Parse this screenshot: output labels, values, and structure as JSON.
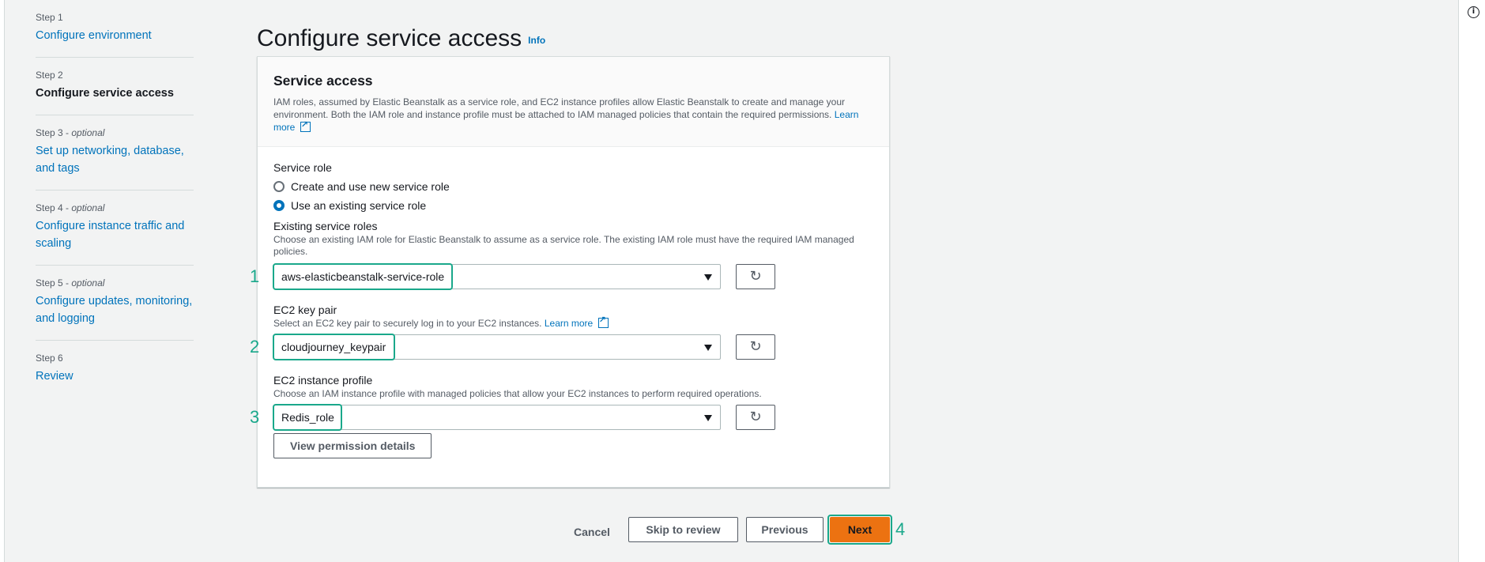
{
  "steps": [
    {
      "num": "Step 1",
      "optional": "",
      "title": "Configure environment"
    },
    {
      "num": "Step 2",
      "optional": "",
      "title": "Configure service access"
    },
    {
      "num": "Step 3",
      "optional": "optional",
      "title": "Set up networking, database, and tags"
    },
    {
      "num": "Step 4",
      "optional": "optional",
      "title": "Configure instance traffic and scaling"
    },
    {
      "num": "Step 5",
      "optional": "optional",
      "title": "Configure updates, monitoring, and logging"
    },
    {
      "num": "Step 6",
      "optional": "",
      "title": "Review"
    }
  ],
  "page": {
    "title": "Configure service access",
    "info": "Info"
  },
  "panel": {
    "title": "Service access",
    "description": "IAM roles, assumed by Elastic Beanstalk as a service role, and EC2 instance profiles allow Elastic Beanstalk to create and manage your environment. Both the IAM role and instance profile must be attached to IAM managed policies that contain the required permissions.",
    "learn_more": "Learn more"
  },
  "service_role": {
    "label": "Service role",
    "option_new": "Create and use new service role",
    "option_existing": "Use an existing service role",
    "selected": "existing"
  },
  "existing_roles": {
    "label": "Existing service roles",
    "description": "Choose an existing IAM role for Elastic Beanstalk to assume as a service role. The existing IAM role must have the required IAM managed policies.",
    "value": "aws-elasticbeanstalk-service-role",
    "marker": "1"
  },
  "key_pair": {
    "label": "EC2 key pair",
    "description": "Select an EC2 key pair to securely log in to your EC2 instances.",
    "learn_more": "Learn more",
    "value": "cloudjourney_keypair",
    "marker": "2"
  },
  "instance_profile": {
    "label": "EC2 instance profile",
    "description": "Choose an IAM instance profile with managed policies that allow your EC2 instances to perform required operations.",
    "value": "Redis_role",
    "marker": "3"
  },
  "view_permissions": "View permission details",
  "footer": {
    "cancel": "Cancel",
    "skip": "Skip to review",
    "previous": "Previous",
    "next": "Next",
    "marker": "4"
  },
  "colors": {
    "link": "#0073bb",
    "primary": "#ec7211",
    "highlight": "#1aa88b"
  },
  "icons": {
    "refresh": "refresh-icon",
    "external": "external-link-icon",
    "info": "info-icon"
  }
}
